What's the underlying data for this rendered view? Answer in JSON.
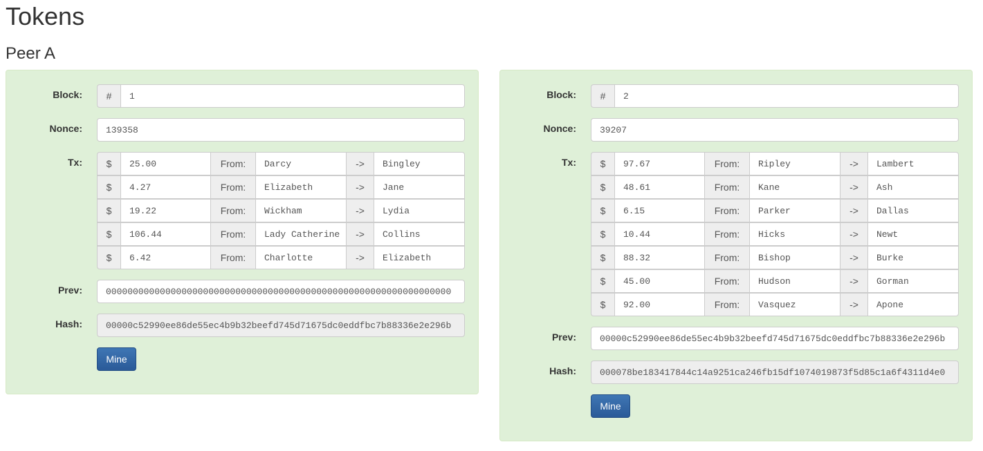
{
  "page_title": "Tokens",
  "peer_title": "Peer A",
  "labels": {
    "block": "Block:",
    "nonce": "Nonce:",
    "tx": "Tx:",
    "prev": "Prev:",
    "hash": "Hash:",
    "hash_addon": "#",
    "dollar": "$",
    "from": "From:",
    "arrow": "->",
    "mine": "Mine"
  },
  "blocks": [
    {
      "block": "1",
      "nonce": "139358",
      "txs": [
        {
          "amount": "25.00",
          "from": "Darcy",
          "to": "Bingley"
        },
        {
          "amount": "4.27",
          "from": "Elizabeth",
          "to": "Jane"
        },
        {
          "amount": "19.22",
          "from": "Wickham",
          "to": "Lydia"
        },
        {
          "amount": "106.44",
          "from": "Lady Catherine",
          "to": "Collins"
        },
        {
          "amount": "6.42",
          "from": "Charlotte",
          "to": "Elizabeth"
        }
      ],
      "prev": "0000000000000000000000000000000000000000000000000000000000000000",
      "hash": "00000c52990ee86de55ec4b9b32beefd745d71675dc0eddfbc7b88336e2e296b"
    },
    {
      "block": "2",
      "nonce": "39207",
      "txs": [
        {
          "amount": "97.67",
          "from": "Ripley",
          "to": "Lambert"
        },
        {
          "amount": "48.61",
          "from": "Kane",
          "to": "Ash"
        },
        {
          "amount": "6.15",
          "from": "Parker",
          "to": "Dallas"
        },
        {
          "amount": "10.44",
          "from": "Hicks",
          "to": "Newt"
        },
        {
          "amount": "88.32",
          "from": "Bishop",
          "to": "Burke"
        },
        {
          "amount": "45.00",
          "from": "Hudson",
          "to": "Gorman"
        },
        {
          "amount": "92.00",
          "from": "Vasquez",
          "to": "Apone"
        }
      ],
      "prev": "00000c52990ee86de55ec4b9b32beefd745d71675dc0eddfbc7b88336e2e296b",
      "hash": "000078be183417844c14a9251ca246fb15df1074019873f5d85c1a6f4311d4e0"
    }
  ],
  "colors": {
    "card_bg": "#dff0d8",
    "card_border": "#d6e9c6",
    "button_bg": "#3266a8",
    "addon_bg": "#eeeeee"
  }
}
